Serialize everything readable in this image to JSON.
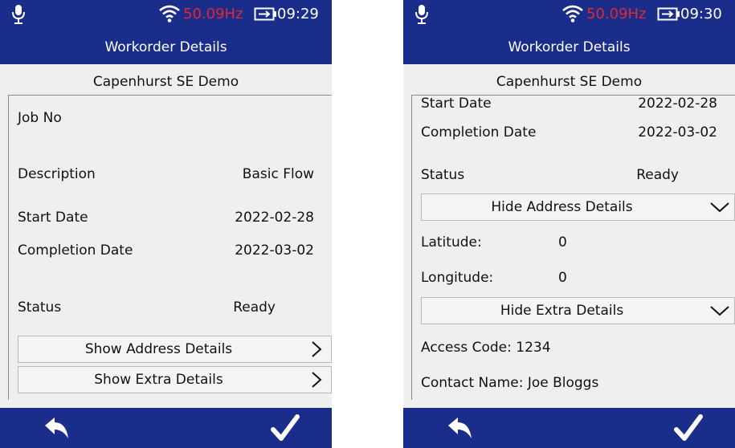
{
  "screens": [
    {
      "status": {
        "frequency": "50.09Hz",
        "time": "09:29"
      },
      "title": "Workorder Details",
      "card_title": "Capenhurst SE Demo",
      "fields": {
        "job_no_label": "Job No",
        "description_label": "Description",
        "description_value": "Basic Flow",
        "start_date_label": "Start Date",
        "start_date_value": "2022-02-28",
        "completion_date_label": "Completion Date",
        "completion_date_value": "2022-03-02",
        "status_label": "Status",
        "status_value": "Ready"
      },
      "buttons": {
        "address": "Show Address Details",
        "extra": "Show Extra Details"
      }
    },
    {
      "status": {
        "frequency": "50.09Hz",
        "time": "09:30"
      },
      "title": "Workorder Details",
      "card_title": "Capenhurst SE Demo",
      "fields": {
        "start_date_label": "Start Date",
        "start_date_value": "2022-02-28",
        "completion_date_label": "Completion Date",
        "completion_date_value": "2022-03-02",
        "status_label": "Status",
        "status_value": "Ready",
        "latitude_label": "Latitude:",
        "latitude_value": "0",
        "longitude_label": "Longitude:",
        "longitude_value": "0",
        "access_code": "Access Code: 1234",
        "contact_name": "Contact Name: Joe Bloggs"
      },
      "buttons": {
        "address": "Hide Address Details",
        "extra": "Hide Extra Details"
      }
    }
  ],
  "icons": {
    "status": [
      "microphone-icon",
      "wifi-icon",
      "battery-icon"
    ],
    "bottom": [
      "back-arrow-icon",
      "checkmark-icon"
    ],
    "buttons": [
      "chevron-right-icon",
      "chevron-down-icon"
    ]
  },
  "colors": {
    "bar": "#1a2d8a",
    "frequency": "#e3262f",
    "background": "#efefef"
  }
}
